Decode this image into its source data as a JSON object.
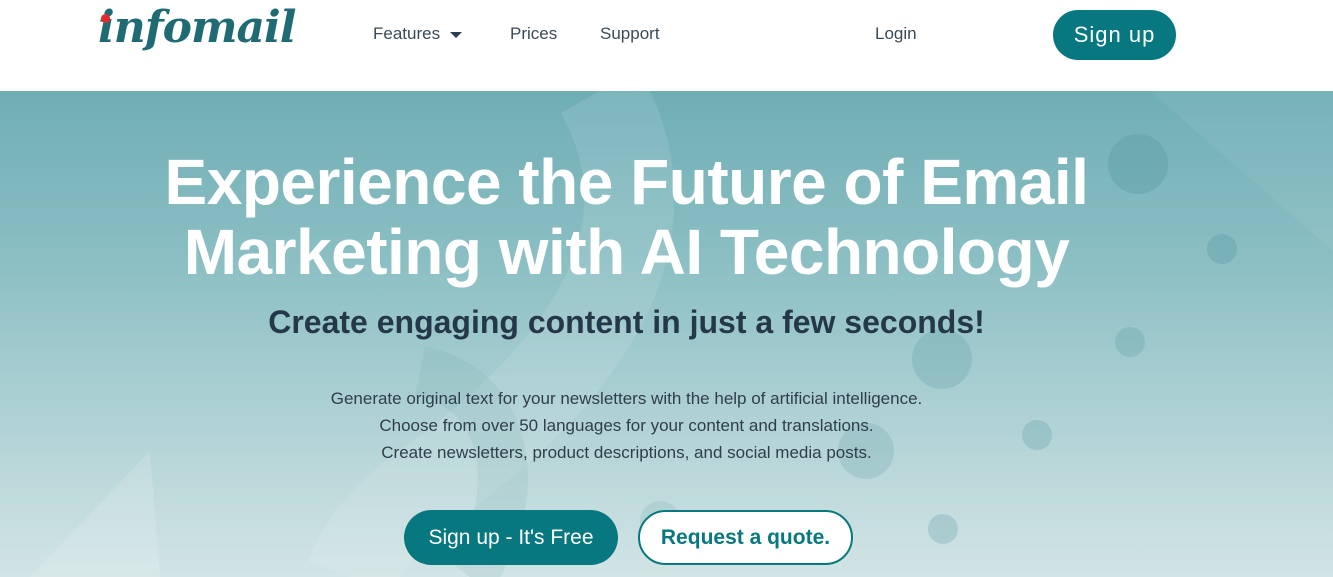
{
  "header": {
    "logo_text": "infomail",
    "nav": {
      "features": "Features",
      "prices": "Prices",
      "support": "Support",
      "login": "Login"
    },
    "signup_label": "Sign up"
  },
  "hero": {
    "title_line1": "Experience the Future of Email",
    "title_line2": "Marketing with AI Technology",
    "subtitle": "Create engaging content in just a few seconds!",
    "description": [
      "Generate original text for your newsletters with the help of artificial intelligence.",
      "Choose from over 50 languages for your content and translations.",
      "Create newsletters, product descriptions, and social media posts."
    ],
    "primary_cta": "Sign up - It's Free",
    "secondary_cta": "Request a quote."
  },
  "colors": {
    "brand": "#07787f",
    "logo": "#1f6b74",
    "logo_dot": "#e32b2b",
    "hero_top": "#6faeb5",
    "hero_bottom": "#d2e4e5"
  },
  "icons": {
    "features_dropdown": "caret-down-icon"
  }
}
